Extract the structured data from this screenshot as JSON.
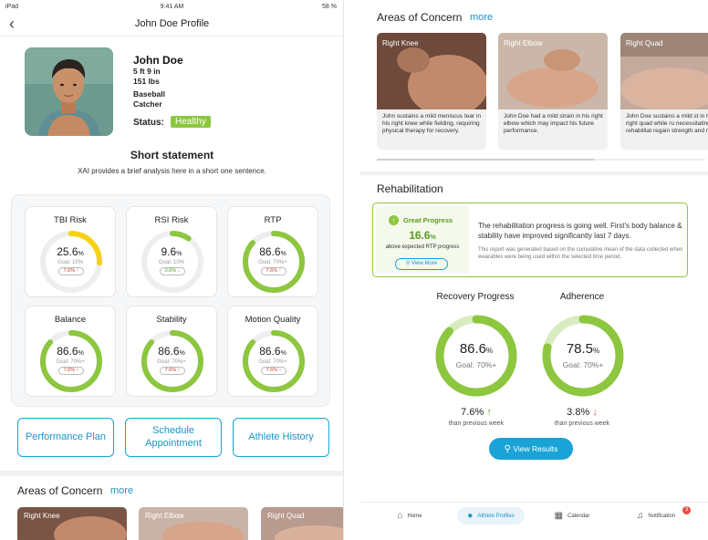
{
  "status_bar": {
    "carrier": "iPad",
    "time": "9:41 AM",
    "battery": "58 %"
  },
  "header": {
    "title": "John Doe Profile",
    "back_icon": "chevron-left-icon"
  },
  "profile": {
    "name": "John Doe",
    "height": "5 ft 9 in",
    "weight": "151 lbs",
    "sport": "Baseball",
    "position": "Catcher",
    "status_label": "Status:",
    "status_value": "Healthy"
  },
  "summary": {
    "title": "Short statement",
    "text": "XAI provides a brief analysis here in a short one sentence."
  },
  "metrics": [
    {
      "title": "TBI Risk",
      "value": "25.6",
      "unit": "%",
      "goal": "Goal: 10%",
      "change": "7.6%",
      "change_dir": "up",
      "fill": 0.256,
      "color": "#f5d313"
    },
    {
      "title": "RSI Risk",
      "value": "9.6",
      "unit": "%",
      "goal": "Goal: 10%",
      "change": "0.6%",
      "change_dir": "down",
      "fill": 0.096,
      "color": "#8dc63f"
    },
    {
      "title": "RTP",
      "value": "86.6",
      "unit": "%",
      "goal": "Goal: 70%+",
      "change": "7.6%",
      "change_dir": "up",
      "fill": 0.866,
      "color": "#8dc63f"
    },
    {
      "title": "Balance",
      "value": "86.6",
      "unit": "%",
      "goal": "Goal: 70%+",
      "change": "7.6%",
      "change_dir": "up",
      "fill": 0.866,
      "color": "#8dc63f"
    },
    {
      "title": "Stability",
      "value": "86.6",
      "unit": "%",
      "goal": "Goal: 70%+",
      "change": "7.6%",
      "change_dir": "up",
      "fill": 0.866,
      "color": "#8dc63f"
    },
    {
      "title": "Motion Quality",
      "value": "86.6",
      "unit": "%",
      "goal": "Goal: 70%+",
      "change": "7.6%",
      "change_dir": "up",
      "fill": 0.866,
      "color": "#8dc63f"
    }
  ],
  "actions": {
    "performance_plan": "Performance Plan",
    "schedule_appointment": "Schedule Appointment",
    "athlete_history": "Athlete History"
  },
  "areas_of_concern": {
    "title": "Areas of Concern",
    "more": "more",
    "items": [
      {
        "label": "Right Knee",
        "description": "John sustains a mild meniscus tear in his right knee while fielding, requiring physical therapy for recovery."
      },
      {
        "label": "Right Elbow",
        "description": "John Doe had a mild strain in his right elbow which may impact his future performance."
      },
      {
        "label": "Right Quad",
        "description": "John Doe sustains a mild st in his right quad while ru necessitating rehabilitat regain strength and mol"
      }
    ]
  },
  "rehabilitation": {
    "title": "Rehabilitation",
    "progress_label": "Great Progress",
    "progress_value": "16.6",
    "progress_unit": "%",
    "progress_sub": "above expected RTP progress",
    "view_more": "View More",
    "text": "The rehabilitation progress is going well. First's body balance & stability have improved significantly last 7 days.",
    "note": "This report was generated based on the cumulative mean of the data collected when wearables were being used within the selected time period.",
    "recovery": {
      "label": "Recovery Progress",
      "value": "86.6",
      "unit": "%",
      "goal": "Goal: 70%+",
      "change": "7.6%",
      "change_dir": "up",
      "sub": "than previous week",
      "fill": 0.866
    },
    "adherence": {
      "label": "Adherence",
      "value": "78.5",
      "unit": "%",
      "goal": "Goal: 70%+",
      "change": "3.8%",
      "change_dir": "down",
      "sub": "than previous week",
      "fill": 0.785
    },
    "view_results": "View Results"
  },
  "tabbar": {
    "home": "Home",
    "athlete_profiles": "Athlete Profiles",
    "calendar": "Calendar",
    "notification": "Notification",
    "notification_count": "3"
  },
  "colors": {
    "accent": "#1aa3d6",
    "success": "#8dc63f",
    "warning": "#f5d313",
    "danger": "#e74c3c"
  }
}
